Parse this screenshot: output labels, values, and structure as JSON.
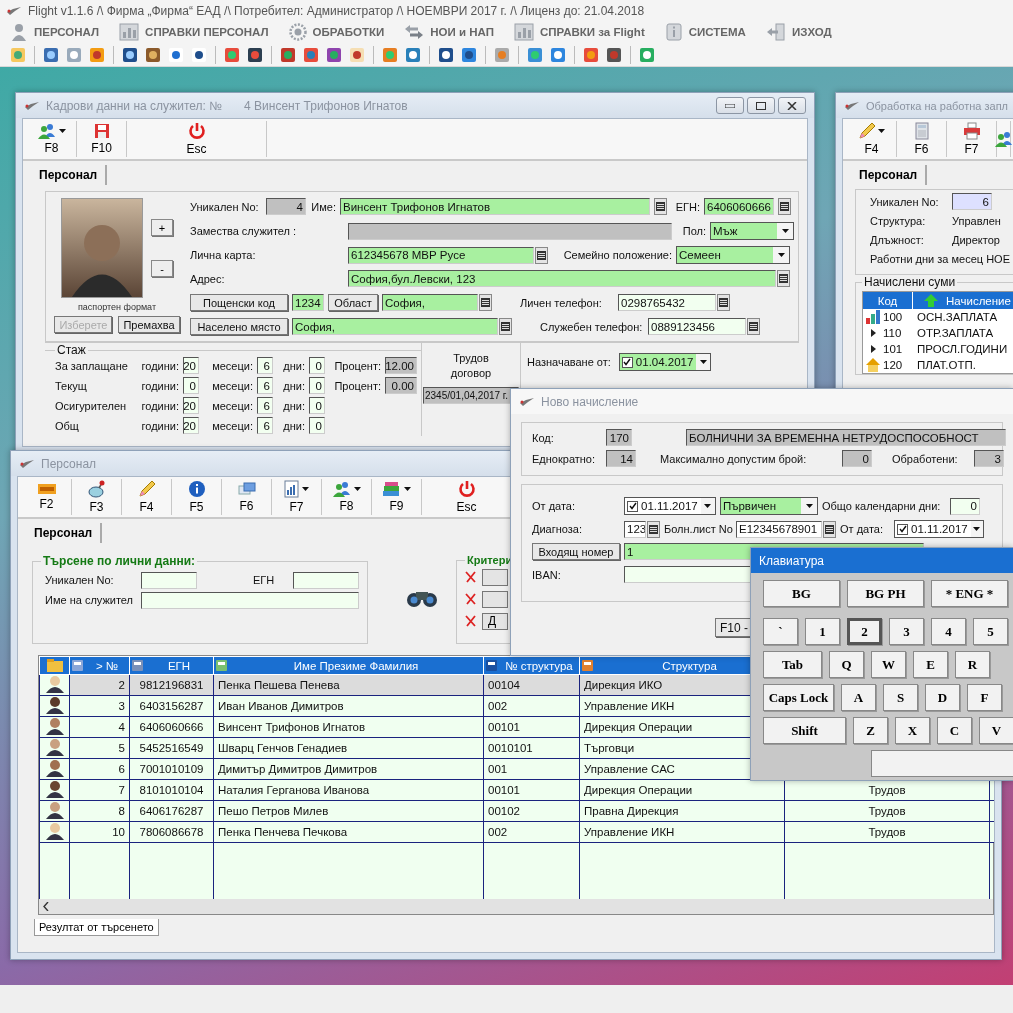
{
  "app_title": "Flight v1.1.6 /\\ Фирма „Фирма“ ЕАД /\\ Потребител: Администратор /\\ НОЕМВРИ 2017 г. /\\ Лиценз до: 21.04.2018",
  "menu": [
    {
      "label": "ПЕРСОНАЛ",
      "kind": "person"
    },
    {
      "label": "СПРАВКИ ПЕРСОНАЛ",
      "kind": "chart"
    },
    {
      "label": "ОБРАБОТКИ",
      "kind": "gear"
    },
    {
      "label": "НОИ и НАП",
      "kind": "arrows"
    },
    {
      "label": "СПРАВКИ за Flight",
      "kind": "chart"
    },
    {
      "label": "СИСТЕМА",
      "kind": "info"
    },
    {
      "label": "ИЗХОД",
      "kind": "exit"
    }
  ],
  "employee_window": {
    "title": "Кадрови данни на служител: №",
    "title_detail": "4 Винсент Трифонов Игнатов",
    "toolbar": [
      {
        "key": "F8",
        "kind": "people",
        "menu": true
      },
      {
        "key": "F10",
        "kind": "save",
        "menu": false
      },
      {
        "key": "Esc",
        "kind": "power",
        "menu": false
      }
    ],
    "tab": "Персонал",
    "photo_caption": "паспортен формат",
    "zoom_buttons": [
      "+",
      "-"
    ],
    "photo_buttons": [
      {
        "label": "Изберете",
        "disabled": true
      },
      {
        "label": "Премахва",
        "disabled": false
      }
    ],
    "unique_no": {
      "label": "Уникален No:",
      "value": "4"
    },
    "name": {
      "label": "Име:",
      "value": "Винсент Трифонов Игнатов"
    },
    "egn": {
      "label": "ЕГН:",
      "value": "6406060666"
    },
    "substitute": {
      "label": "Замества служител :"
    },
    "gender": {
      "label": "Пол:",
      "value": "Мъж"
    },
    "id_card": {
      "label": "Лична карта:",
      "value": "612345678 МВР Русе"
    },
    "marital": {
      "label": "Семейно положение:",
      "value": "Семеен"
    },
    "address": {
      "label": "Адрес:",
      "value": "София,бул.Левски, 123"
    },
    "postcode": {
      "button": "Пощенски код",
      "value": "1234"
    },
    "region": {
      "button": "Област",
      "value": "София,"
    },
    "town": {
      "button": "Населено място",
      "value": "София,"
    },
    "personal_phone": {
      "label": "Личен телефон:",
      "value": "0298765432"
    },
    "work_phone": {
      "label": "Служебен телефон:",
      "value": "0889123456"
    },
    "seniority": {
      "title": "Стаж",
      "rows": [
        {
          "label": "За заплащане",
          "years_label": "години:",
          "years": "20",
          "months_label": "месеци:",
          "months": "6",
          "days_label": "дни:",
          "days": "0",
          "percent_label": "Процент:",
          "percent": "12.00"
        },
        {
          "label": "Текущ",
          "years_label": "години:",
          "years": "0",
          "months_label": "месеци:",
          "months": "6",
          "days_label": "дни:",
          "days": "0",
          "percent_label": "Процент:",
          "percent": "0.00"
        },
        {
          "label": "Осигурителен",
          "years_label": "години:",
          "years": "20",
          "months_label": "месеци:",
          "months": "6",
          "days_label": "дни:",
          "days": "0"
        },
        {
          "label": "Общ",
          "years_label": "години:",
          "years": "20",
          "months_label": "месеци:",
          "months": "6",
          "days_label": "дни:",
          "days": "0"
        }
      ]
    },
    "contract": {
      "label": "Трудов договор",
      "value": "2345/01,04,2017 г."
    },
    "appointment": {
      "label": "Назначаване от:",
      "date": "01.04.2017",
      "checked": true
    }
  },
  "payroll_window": {
    "title": "Обработка на работна запл",
    "toolbar": [
      {
        "key": "F4",
        "kind": "pencil",
        "menu": true
      },
      {
        "key": "F6",
        "kind": "calculator",
        "menu": false
      },
      {
        "key": "F7",
        "kind": "printer",
        "menu": false
      }
    ],
    "tab": "Персонал",
    "unique_no": {
      "label": "Уникален No:",
      "value": "6"
    },
    "info": [
      {
        "label": "Структура:",
        "value": "Управлен"
      },
      {
        "label": "Длъжност:",
        "value": "Директор"
      }
    ],
    "work_days": "Работни дни за месец НОЕ",
    "accruals": {
      "title": "Начислени суми",
      "columns": [
        "Код",
        "Начисление"
      ],
      "rows": [
        {
          "code": "100",
          "name": "ОСН.ЗАПЛАТА",
          "kind": "chart"
        },
        {
          "code": "110",
          "name": "ОТР.ЗАПЛАТА",
          "kind": "arrow"
        },
        {
          "code": "101",
          "name": "ПРОСЛ.ГОДИНИ",
          "kind": "arrow"
        },
        {
          "code": "120",
          "name": "ПЛАТ.ОТП.",
          "kind": "house"
        }
      ]
    }
  },
  "staff_window": {
    "title": "Персонал",
    "toolbar": [
      {
        "key": "F2",
        "kind": "new",
        "menu": false
      },
      {
        "key": "F3",
        "kind": "globe",
        "menu": false
      },
      {
        "key": "F4",
        "kind": "pencil",
        "menu": false
      },
      {
        "key": "F5",
        "kind": "info",
        "menu": false
      },
      {
        "key": "F6",
        "kind": "window",
        "menu": false
      },
      {
        "key": "F7",
        "kind": "chart",
        "menu": true
      },
      {
        "key": "F8",
        "kind": "people",
        "menu": true
      },
      {
        "key": "F9",
        "kind": "books",
        "menu": true
      },
      {
        "key": "Esc",
        "kind": "power",
        "menu": false
      }
    ],
    "tab": "Персонал",
    "search": {
      "title": "Търсене по лични данни:",
      "unique_no_label": "Уникален No:",
      "egn_label": "ЕГН",
      "name_label": "Име на служител"
    },
    "criteria": {
      "title": "Критери",
      "last_button": "Д"
    },
    "table": {
      "columns": [
        "> №",
        "ЕГН",
        "Име Презиме Фамилия",
        "№ структура",
        "Структура"
      ],
      "rows": [
        {
          "no": "2",
          "egn": "9812196831",
          "name": "Пенка Пешева Пенева",
          "structure_no": "00104",
          "structure": "Дирекция ИКО",
          "selected": true
        },
        {
          "no": "3",
          "egn": "6403156287",
          "name": "Иван Иванов Димитров",
          "structure_no": "002",
          "structure": "Управление ИКН",
          "selected": false
        },
        {
          "no": "4",
          "egn": "6406060666",
          "name": "Винсент Трифонов Игнатов",
          "structure_no": "00101",
          "structure": "Дирекция Операции",
          "selected": false
        },
        {
          "no": "5",
          "egn": "5452516549",
          "name": "Шварц Генчов Генадиев",
          "structure_no": "0010101",
          "structure": "Търговци",
          "selected": false
        },
        {
          "no": "6",
          "egn": "7001010109",
          "name": "Димитър Димитров Димитров",
          "structure_no": "001",
          "structure": "Управление САС",
          "selected": false
        },
        {
          "no": "7",
          "egn": "8101010104",
          "name": "Наталия Герганова Иванова",
          "structure_no": "00101",
          "structure": "Дирекция Операции",
          "column_7": "Трудов",
          "selected": false
        },
        {
          "no": "8",
          "egn": "6406176287",
          "name": "Пешо Петров Милев",
          "structure_no": "00102",
          "structure": "Правна Дирекция",
          "column_7": "Трудов",
          "selected": false
        },
        {
          "no": "10",
          "egn": "7806086678",
          "name": "Пенка Пенчева Печкова",
          "structure_no": "002",
          "structure": "Управление ИКН",
          "column_7": "Трудов",
          "selected": false
        }
      ]
    },
    "result_tab": "Резултат от търсенето"
  },
  "accrual_window": {
    "title": "Ново начисление",
    "code_label": "Код:",
    "code": "170",
    "code_name": "БОЛНИЧНИ ЗА ВРЕМЕННА НЕТРУДОСПОСОБНОСТ",
    "once_label": "Еднократно:",
    "once": "14",
    "max_label": "Максимално допустим брой:",
    "max": "0",
    "processed_label": "Обработени:",
    "processed": "3",
    "from_label": "От дата:",
    "from_date": "01.11.2017",
    "from_checked": true,
    "type": "Първичен",
    "days_label": "Общо календарни дни:",
    "days": "0",
    "diagnosis_label": "Диагноза:",
    "diagnosis": "123",
    "sheet_label": "Болн.лист No",
    "sheet": "E12345678901",
    "from2_label": "От дата:",
    "from2_date": "01.11.2017",
    "from2_checked": true,
    "incoming_button": "Входящ номер",
    "incoming": "1",
    "iban_label": "IBAN:",
    "save_button": "F10 -"
  },
  "keyboard": {
    "title": "Клавиатура",
    "rows": [
      {
        "keys": [
          {
            "label": "BG",
            "kind": "layout",
            "selected": false
          },
          {
            "label": "BG PH",
            "kind": "layout",
            "selected": false
          },
          {
            "label": "* ENG *",
            "kind": "layout",
            "selected": false
          }
        ]
      },
      {
        "keys": [
          {
            "label": "`",
            "kind": "key",
            "selected": false
          },
          {
            "label": "1",
            "kind": "key",
            "selected": false
          },
          {
            "label": "2",
            "kind": "key",
            "selected": true
          },
          {
            "label": "3",
            "kind": "key",
            "selected": false
          },
          {
            "label": "4",
            "kind": "key",
            "selected": false
          },
          {
            "label": "5",
            "kind": "key",
            "selected": false
          }
        ]
      },
      {
        "keys": [
          {
            "label": "Tab",
            "kind": "tab",
            "selected": false
          },
          {
            "label": "Q",
            "kind": "key",
            "selected": false
          },
          {
            "label": "W",
            "kind": "key",
            "selected": false
          },
          {
            "label": "E",
            "kind": "key",
            "selected": false
          },
          {
            "label": "R",
            "kind": "key",
            "selected": false
          }
        ]
      },
      {
        "keys": [
          {
            "label": "Caps Lock",
            "kind": "caps",
            "selected": false
          },
          {
            "label": "A",
            "kind": "key",
            "selected": false
          },
          {
            "label": "S",
            "kind": "key",
            "selected": false
          },
          {
            "label": "D",
            "kind": "key",
            "selected": false
          },
          {
            "label": "F",
            "kind": "key",
            "selected": false
          }
        ]
      },
      {
        "keys": [
          {
            "label": "Shift",
            "kind": "shift",
            "selected": false
          },
          {
            "label": "Z",
            "kind": "key",
            "selected": false
          },
          {
            "label": "X",
            "kind": "key",
            "selected": false
          },
          {
            "label": "C",
            "kind": "key",
            "selected": false
          },
          {
            "label": "V",
            "kind": "key",
            "selected": false
          }
        ]
      },
      {
        "keys": [
          {
            "kind": "space",
            "selected": false
          }
        ]
      }
    ]
  }
}
